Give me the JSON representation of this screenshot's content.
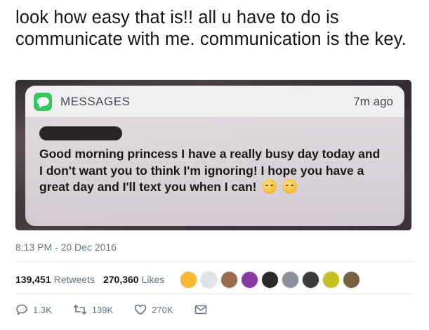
{
  "tweet": {
    "text": "look how easy that is!! all u have to do is communicate with me. communication is the key.",
    "timestamp": "8:13 PM - 20 Dec 2016"
  },
  "notification": {
    "app_name": "MESSAGES",
    "time": "7m ago",
    "message": "Good morning princess I have a really busy day today and I don't want you to think I'm ignoring! I hope you have a great day and I'll text you when I can!",
    "emoji_icons": [
      "kissing-face-icon",
      "smiling-face-icon"
    ],
    "app_color": "#34c759"
  },
  "stats": {
    "retweets_count": "139,451",
    "retweets_label": "Retweets",
    "likes_count": "270,360",
    "likes_label": "Likes",
    "avatar_colors": [
      "#f5b82e",
      "#dfe3e6",
      "#9a6a4a",
      "#8a3aa0",
      "#2a2a2a",
      "#8a8f9a",
      "#3a3a3a",
      "#c8c020",
      "#7a6040"
    ]
  },
  "actions": {
    "reply": "1.3K",
    "retweet": "139K",
    "like": "270K"
  },
  "colors": {
    "text": "#14171a",
    "secondary": "#657786"
  }
}
